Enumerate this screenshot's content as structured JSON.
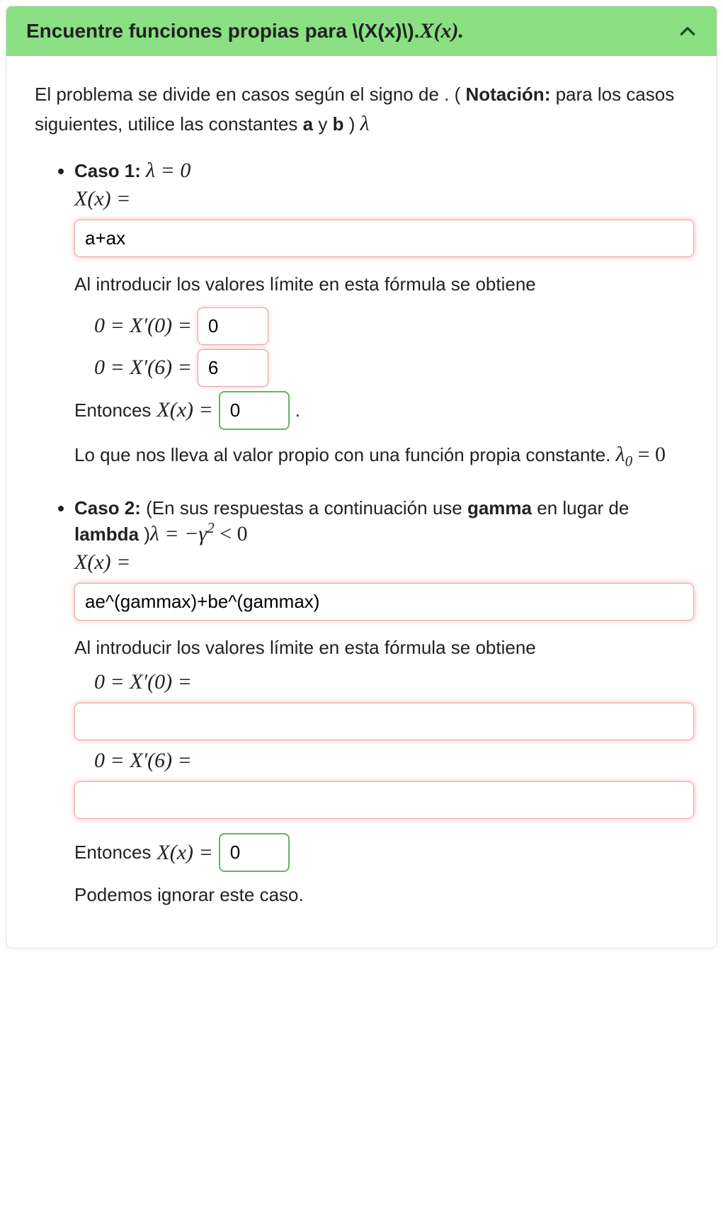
{
  "header": {
    "prefix": "Encuentre funciones propias para \\(X(x)\\).",
    "math": "X(x)."
  },
  "intro": {
    "line1_a": "El problema se divide en casos según el signo de .    ( ",
    "line2_a": "Notación:",
    "line2_b": " para los casos siguientes, utilice las constantes ",
    "line2_c": "a",
    "line2_d": " y ",
    "line2_e": "b",
    "line2_f": " ) ",
    "line2_g": "λ"
  },
  "case1": {
    "label": "Caso 1:",
    "cond": "λ = 0",
    "xx": "X(x) =",
    "input1": "a+ax",
    "text1": "Al introducir los valores límite en esta fórmula se obtiene",
    "eq1_lhs": "0 = X′(0) =",
    "eq1_val": "0",
    "eq2_lhs": "0 = X′(6) =",
    "eq2_val": "6",
    "ent_a": "Entonces",
    "ent_math": "X(x) =",
    "ent_val": "0",
    "ent_dot": ".",
    "text2a": "Lo que nos lleva al valor propio con una función propia constante. ",
    "text2b": "λ",
    "text2b_sub": "0",
    "text2c": " = 0"
  },
  "case2": {
    "label": "Caso 2:",
    "note": "    (En sus respuestas a continuación use ",
    "gamma": "gamma",
    "note2": " en lugar de ",
    "lambda": "lambda",
    "note3": " )",
    "cond_a": "λ = −γ",
    "cond_exp": "2",
    "cond_b": " < 0",
    "xx": "X(x) =",
    "input1": "ae^(gammax)+be^(gammax)",
    "text1": "Al introducir los valores límite en esta fórmula se obtiene",
    "eq1_lhs": "0 = X′(0) =",
    "eq1_val": "",
    "eq2_lhs": "0 = X′(6) =",
    "eq2_val": "",
    "ent_a": "Entonces",
    "ent_math": "X(x) =",
    "ent_val": "0",
    "text2": "Podemos ignorar este caso."
  }
}
